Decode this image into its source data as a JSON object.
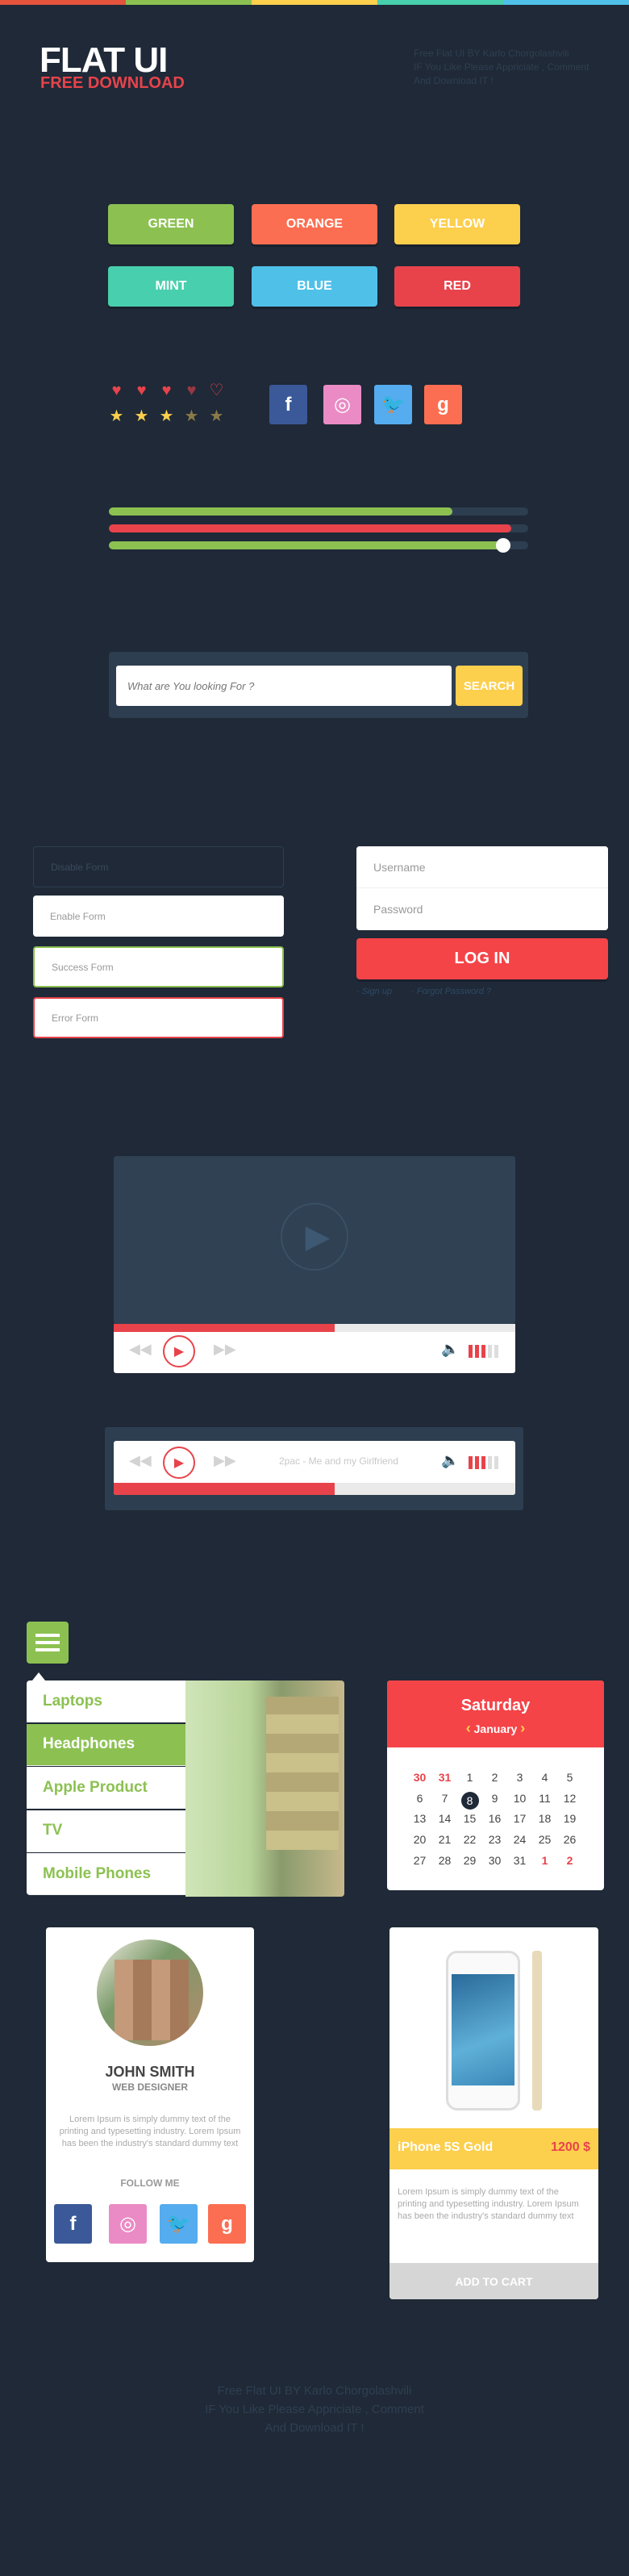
{
  "colors": {
    "green": "#8cc152",
    "orange": "#fc6e51",
    "yellow": "#fccf4d",
    "mint": "#48cfad",
    "blue": "#4fc1e9",
    "red": "#e8434b",
    "background": "#1f2937"
  },
  "stripe": [
    "#e5533d",
    "#8cc152",
    "#fccf4d",
    "#48cfad",
    "#4fc1e9"
  ],
  "header": {
    "title": "FLAT UI",
    "subtitle": "FREE DOWNLOAD",
    "note": [
      "Free Flat UI  BY Karlo Chorgolashvili",
      "IF You Like Please Appriciate , Comment",
      "And Download IT !"
    ]
  },
  "buttons": [
    {
      "label": "GREEN",
      "color": "#8cc152"
    },
    {
      "label": "ORANGE",
      "color": "#fc6e51"
    },
    {
      "label": "YELLOW",
      "color": "#fccf4d"
    },
    {
      "label": "MINT",
      "color": "#48cfad"
    },
    {
      "label": "BLUE",
      "color": "#4fc1e9"
    },
    {
      "label": "RED",
      "color": "#e8434b"
    }
  ],
  "rating": {
    "hearts": 3.5,
    "hearts_max": 5,
    "stars": 3,
    "stars_max": 5
  },
  "social": [
    {
      "icon": "facebook-icon",
      "glyph": "f",
      "color": "#3b5998"
    },
    {
      "icon": "dribbble-icon",
      "glyph": "◎",
      "color": "#ea8bc5"
    },
    {
      "icon": "twitter-icon",
      "glyph": "🐦",
      "color": "#55acee"
    },
    {
      "icon": "google-plus-icon",
      "glyph": "g",
      "color": "#fc6e51"
    }
  ],
  "progress": [
    {
      "value": 82,
      "color": "#8cc152"
    },
    {
      "value": 96,
      "color": "#e8434b"
    },
    {
      "value": 94,
      "color": "#8cc152",
      "slider": true
    }
  ],
  "search": {
    "placeholder": "What are You looking For ?",
    "button": "SEARCH"
  },
  "forms": {
    "disabled": "Disable Form",
    "enabled": "Enable Form",
    "success": "Success Form",
    "error": "Error Form"
  },
  "login": {
    "username": "Username",
    "password": "Password",
    "button": "LOG IN",
    "signup": "· Sign up",
    "forgot": "· Forgot Password ?"
  },
  "video": {
    "progress": 55,
    "volume": 3,
    "volume_max": 5
  },
  "audio": {
    "track": "2pac - Me and my Girlfriend",
    "progress": 55,
    "volume": 3,
    "volume_max": 5
  },
  "menu": {
    "items": [
      "Laptops",
      "Headphones",
      "Apple Product",
      "TV",
      "Mobile Phones"
    ],
    "active": 1
  },
  "calendar": {
    "weekday": "Saturday",
    "month": "January",
    "prev": "‹",
    "next": "›",
    "selected": "8",
    "days": [
      [
        "30",
        "31",
        "1",
        "2",
        "3",
        "4",
        "5"
      ],
      [
        "6",
        "7",
        "8",
        "9",
        "10",
        "11",
        "12"
      ],
      [
        "13",
        "14",
        "15",
        "16",
        "17",
        "18",
        "19"
      ],
      [
        "20",
        "21",
        "22",
        "23",
        "24",
        "25",
        "26"
      ],
      [
        "27",
        "28",
        "29",
        "30",
        "31",
        "1",
        "2"
      ]
    ],
    "other_month": [
      "0-0",
      "0-1",
      "4-5",
      "4-6"
    ]
  },
  "profile": {
    "name": "JOHN SMITH",
    "role": "WEB DESIGNER",
    "bio": "Lorem Ipsum is simply dummy text of the printing and typesetting industry. Lorem Ipsum has been the industry's standard dummy text",
    "follow": "FOLLOW ME"
  },
  "product": {
    "name": "iPhone 5S Gold",
    "price": "1200 $",
    "description": "Lorem Ipsum is simply dummy text of the printing and typesetting industry. Lorem Ipsum has been the industry's standard dummy text",
    "button": "ADD TO CART"
  },
  "footer": [
    "Free Flat UI  BY Karlo Chorgolashvili",
    "IF You Like Please Appriciate , Comment",
    "And Download IT !"
  ]
}
